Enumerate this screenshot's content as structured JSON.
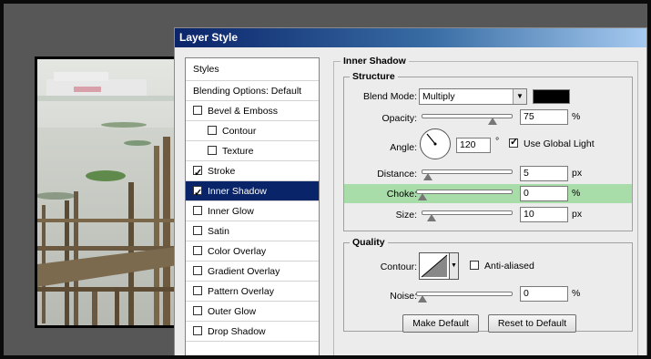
{
  "dialog": {
    "title": "Layer Style"
  },
  "styles_list": {
    "header": "Styles",
    "blending": "Blending Options: Default",
    "items": [
      {
        "label": "Bevel & Emboss",
        "checked": false,
        "indent": false
      },
      {
        "label": "Contour",
        "checked": false,
        "indent": true
      },
      {
        "label": "Texture",
        "checked": false,
        "indent": true
      },
      {
        "label": "Stroke",
        "checked": true,
        "indent": false
      },
      {
        "label": "Inner Shadow",
        "checked": true,
        "indent": false,
        "selected": true
      },
      {
        "label": "Inner Glow",
        "checked": false,
        "indent": false
      },
      {
        "label": "Satin",
        "checked": false,
        "indent": false
      },
      {
        "label": "Color Overlay",
        "checked": false,
        "indent": false
      },
      {
        "label": "Gradient Overlay",
        "checked": false,
        "indent": false
      },
      {
        "label": "Pattern Overlay",
        "checked": false,
        "indent": false
      },
      {
        "label": "Outer Glow",
        "checked": false,
        "indent": false
      },
      {
        "label": "Drop Shadow",
        "checked": false,
        "indent": false
      }
    ]
  },
  "inner_shadow": {
    "title": "Inner Shadow",
    "structure": {
      "title": "Structure",
      "blend_mode_label": "Blend Mode:",
      "blend_mode_value": "Multiply",
      "color": "#000000",
      "opacity_label": "Opacity:",
      "opacity_value": "75",
      "opacity_unit": "%",
      "angle_label": "Angle:",
      "angle_value": "120",
      "angle_unit": "°",
      "use_global_light_label": "Use Global Light",
      "use_global_light": true,
      "distance_label": "Distance:",
      "distance_value": "5",
      "distance_unit": "px",
      "choke_label": "Choke:",
      "choke_value": "0",
      "choke_unit": "%",
      "size_label": "Size:",
      "size_value": "10",
      "size_unit": "px"
    },
    "quality": {
      "title": "Quality",
      "contour_label": "Contour:",
      "anti_aliased_label": "Anti-aliased",
      "anti_aliased": false,
      "noise_label": "Noise:",
      "noise_value": "0",
      "noise_unit": "%"
    },
    "make_default_label": "Make Default",
    "reset_default_label": "Reset to Default"
  },
  "colors": {
    "selection": "#0a246a",
    "highlight": "#a8dca8"
  }
}
